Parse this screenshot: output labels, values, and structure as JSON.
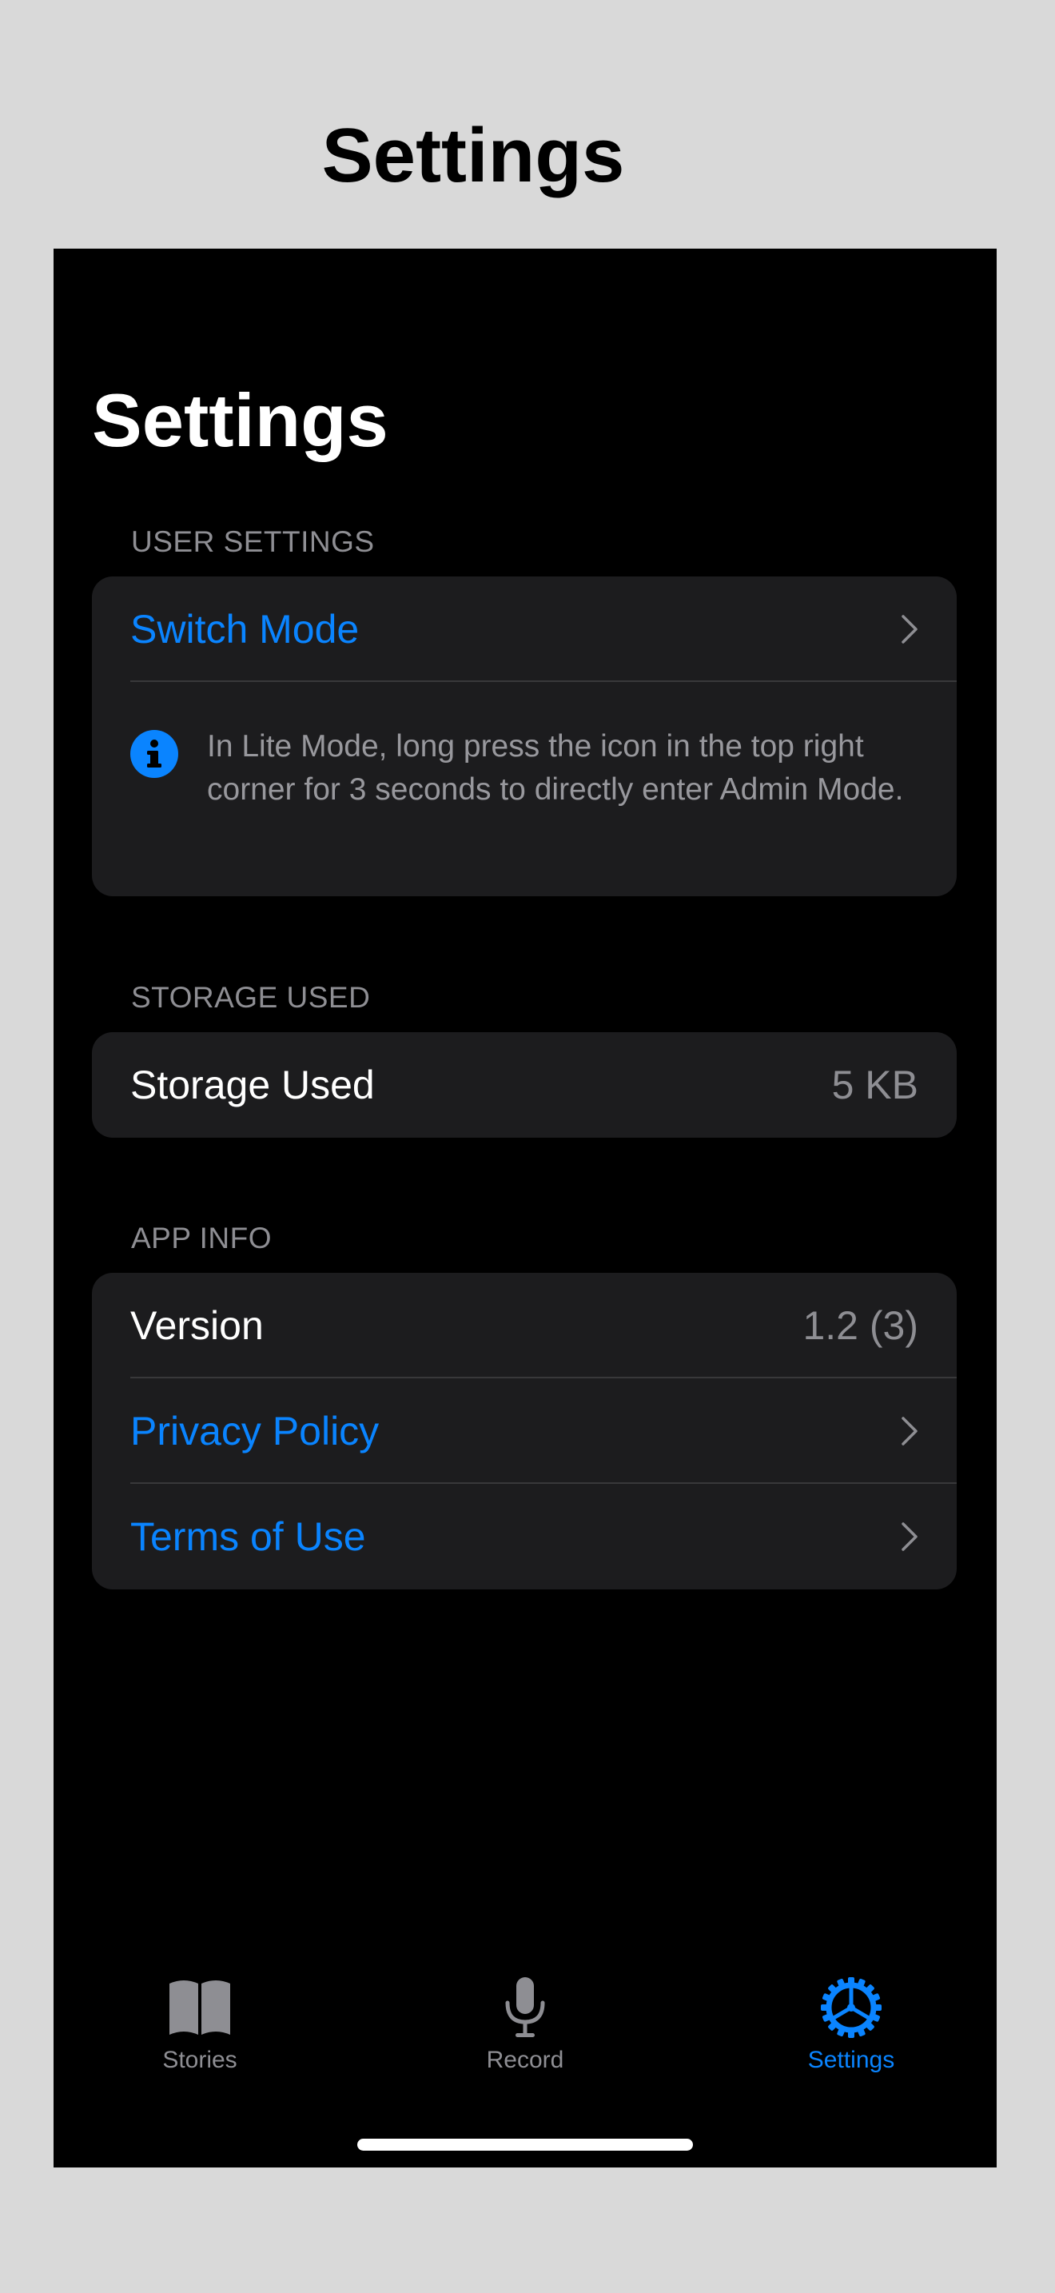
{
  "outer": {
    "title": "Settings"
  },
  "nav": {
    "large_title": "Settings"
  },
  "sections": {
    "user_settings": {
      "header": "USER SETTINGS",
      "switch_mode_label": "Switch Mode",
      "info_text": "In Lite Mode, long press the icon in the top right corner for 3 seconds to directly enter Admin Mode."
    },
    "storage": {
      "header": "STORAGE USED",
      "label": "Storage Used",
      "value": "5 KB"
    },
    "app_info": {
      "header": "APP INFO",
      "version_label": "Version",
      "version_value": "1.2 (3)",
      "privacy_label": "Privacy Policy",
      "terms_label": "Terms of Use"
    }
  },
  "tabbar": {
    "tabs": [
      {
        "label": "Stories",
        "icon": "book-icon",
        "active": false
      },
      {
        "label": "Record",
        "icon": "microphone-icon",
        "active": false
      },
      {
        "label": "Settings",
        "icon": "gear-icon",
        "active": true
      }
    ]
  },
  "colors": {
    "accent": "#0a84ff",
    "background": "#000000",
    "cell": "#1c1c1e",
    "secondary_text": "#8e8e93",
    "page_background": "#d9d9d9"
  }
}
